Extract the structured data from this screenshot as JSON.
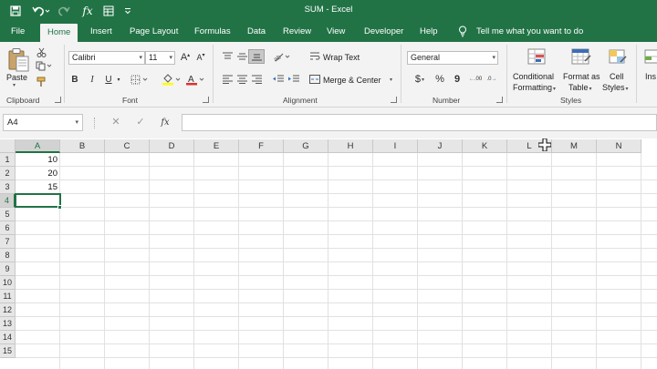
{
  "window": {
    "title": "SUM  -  Excel"
  },
  "quick_access": [
    {
      "name": "save-icon",
      "glyph": "🖫"
    },
    {
      "name": "undo-icon",
      "glyph": "↶"
    },
    {
      "name": "redo-icon",
      "glyph": "↷"
    },
    {
      "name": "function-icon",
      "glyph": "fx"
    },
    {
      "name": "form-icon",
      "glyph": "▤"
    },
    {
      "name": "customize-icon",
      "glyph": "⌄"
    }
  ],
  "tabs": {
    "file": "File",
    "home": "Home",
    "insert": "Insert",
    "page_layout": "Page Layout",
    "formulas": "Formulas",
    "data": "Data",
    "review": "Review",
    "view": "View",
    "developer": "Developer",
    "help": "Help",
    "tell_me": "Tell me what you want to do"
  },
  "ribbon": {
    "clipboard": {
      "label": "Clipboard",
      "paste": "Paste"
    },
    "font": {
      "label": "Font",
      "name": "Calibri",
      "size": "11",
      "bold": "B",
      "italic": "I",
      "underline": "U",
      "grow": "A",
      "shrink": "A"
    },
    "alignment": {
      "label": "Alignment",
      "wrap_text": "Wrap Text",
      "merge_center": "Merge & Center"
    },
    "number": {
      "label": "Number",
      "format": "General",
      "currency": "$",
      "percent": "%",
      "comma": "9",
      "increase_decimal": ".00",
      "decrease_decimal": ".0"
    },
    "styles": {
      "label": "Styles",
      "conditional_1": "Conditional",
      "conditional_2": "Formatting",
      "table_1": "Format as",
      "table_2": "Table",
      "cell_1": "Cell",
      "cell_2": "Styles",
      "insert_cut": "Ins"
    }
  },
  "formula_bar": {
    "name_box": "A4",
    "cancel": "✕",
    "enter": "✓",
    "fx": "fx",
    "value": ""
  },
  "grid": {
    "columns": [
      "A",
      "B",
      "C",
      "D",
      "E",
      "F",
      "G",
      "H",
      "I",
      "J",
      "K",
      "L",
      "M",
      "N"
    ],
    "rows": [
      "1",
      "2",
      "3",
      "4",
      "5",
      "6",
      "7",
      "8",
      "9",
      "10",
      "11",
      "12",
      "13",
      "14",
      "15"
    ],
    "selected_column": "A",
    "selected_row": "4",
    "cells": [
      {
        "ref": "A1",
        "value": "10"
      },
      {
        "ref": "A2",
        "value": "20"
      },
      {
        "ref": "A3",
        "value": "15"
      }
    ]
  },
  "colors": {
    "accent": "#217346",
    "header_bg": "#e6e6e6",
    "gridline": "#e1e1e1"
  }
}
